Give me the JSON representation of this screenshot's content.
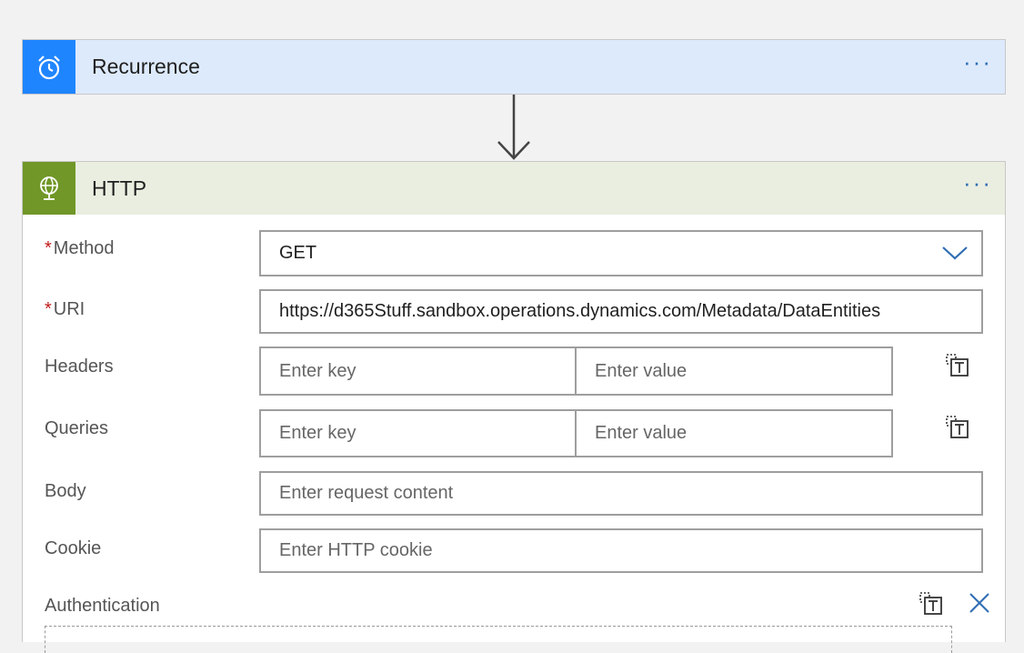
{
  "recurrence": {
    "title": "Recurrence",
    "more": "···"
  },
  "http": {
    "title": "HTTP",
    "more": "···",
    "fields": {
      "method": {
        "label": "Method",
        "required_mark": "*",
        "value": "GET"
      },
      "uri": {
        "label": "URI",
        "required_mark": "*",
        "value": "https://d365Stuff.sandbox.operations.dynamics.com/Metadata/DataEntities"
      },
      "headers": {
        "label": "Headers",
        "key_placeholder": "Enter key",
        "value_placeholder": "Enter value"
      },
      "queries": {
        "label": "Queries",
        "key_placeholder": "Enter key",
        "value_placeholder": "Enter value"
      },
      "body": {
        "label": "Body",
        "placeholder": "Enter request content"
      },
      "cookie": {
        "label": "Cookie",
        "placeholder": "Enter HTTP cookie"
      },
      "authentication": {
        "label": "Authentication"
      }
    }
  },
  "icons": {
    "recurrence": "alarm-clock-icon",
    "http": "globe-icon",
    "kv_mode": "switch-to-text-mode-icon",
    "close": "close-icon",
    "dropdown": "chevron-down-icon"
  },
  "colors": {
    "recurrence_accent": "#1f85ff",
    "recurrence_header_bg": "#ddeafc",
    "http_accent": "#709727",
    "http_header_bg": "#e9eee0",
    "required": "#c01a1a",
    "link_blue": "#2f6db3"
  }
}
